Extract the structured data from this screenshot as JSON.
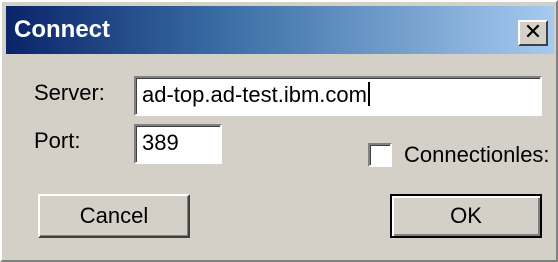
{
  "window": {
    "title": "Connect",
    "close_glyph": "✕",
    "close_icon": "close-icon"
  },
  "form": {
    "server_label": "Server:",
    "server_value": "ad-top.ad-test.ibm.com",
    "port_label": "Port:",
    "port_value": "389",
    "connectionless_label": "Connectionles:",
    "connectionless_checked": false
  },
  "buttons": {
    "cancel": "Cancel",
    "ok": "OK"
  },
  "colors": {
    "titlebar_start": "#0a246a",
    "titlebar_end": "#a6caf0",
    "face": "#d4d0c8"
  }
}
